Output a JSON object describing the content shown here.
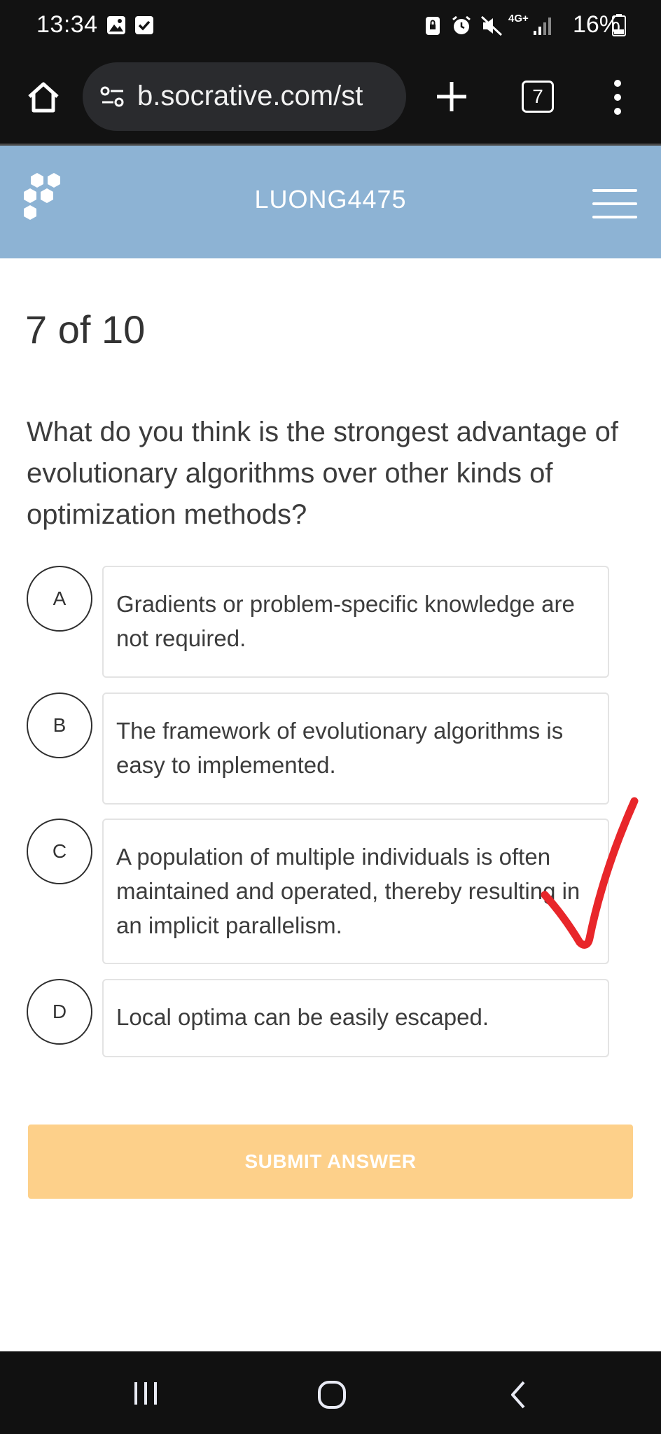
{
  "status_bar": {
    "time": "13:34",
    "network": "4G+",
    "battery": "16%",
    "icons": [
      "gallery-icon",
      "check-icon",
      "lock-icon",
      "alarm-icon",
      "mute-icon",
      "signal-icon",
      "battery-icon"
    ]
  },
  "browser": {
    "url": "b.socrative.com/st",
    "tab_count": "7",
    "icons": [
      "home-icon",
      "tune-icon",
      "plus-icon",
      "tabs-icon",
      "more-vert-icon"
    ]
  },
  "header": {
    "room_name": "LUONG4475",
    "icons": [
      "socrative-logo",
      "menu-icon"
    ],
    "background_color": "#8db3d4"
  },
  "quiz": {
    "progress": "7 of 10",
    "question": "What do you think is the strongest advantage of evolutionary algorithms over other kinds of optimization methods?",
    "answers": [
      {
        "letter": "A",
        "text": "Gradients or problem-specific knowledge are not required."
      },
      {
        "letter": "B",
        "text": "The framework of evolutionary algorithms is easy to implemented."
      },
      {
        "letter": "C",
        "text": "A population of multiple individuals is often maintained and operated, thereby resulting in an implicit parallelism."
      },
      {
        "letter": "D",
        "text": "Local optima can be easily escaped."
      }
    ],
    "submit_label": "SUBMIT ANSWER",
    "submit_color": "#fdd08a",
    "annotation": {
      "icon": "red-check-mark",
      "marks_answer": "C",
      "color": "#e8262a"
    }
  },
  "nav_bar": {
    "icons": [
      "recent-apps-icon",
      "home-nav-icon",
      "back-icon"
    ]
  }
}
